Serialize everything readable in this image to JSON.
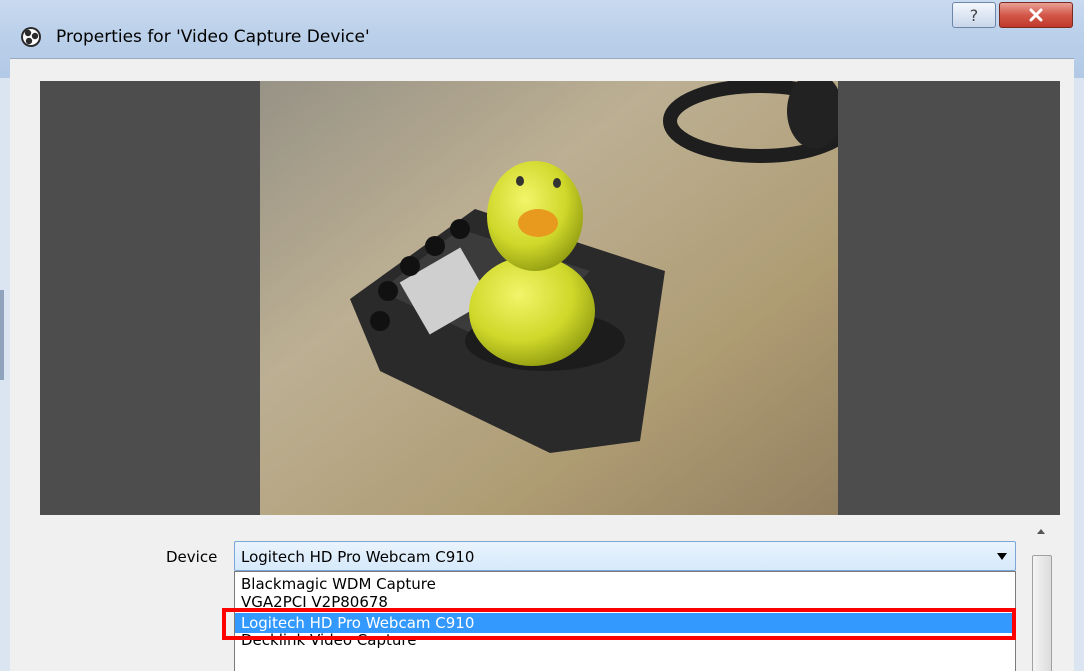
{
  "window": {
    "title": "Properties for 'Video Capture Device'",
    "help_label": "?",
    "icons": {
      "app": "obs-logo-icon",
      "help": "help-icon",
      "close": "close-icon"
    },
    "colors": {
      "close_button": "#c0392b",
      "selection": "#3399ff",
      "highlight_outline": "#ff0000",
      "preview_background": "#4d4d4d"
    }
  },
  "device": {
    "label": "Device",
    "selected": "Logitech HD Pro Webcam C910",
    "options": [
      "Blackmagic WDM Capture",
      "VGA2PCI V2P80678",
      "Logitech HD Pro Webcam C910",
      "Decklink Video Capture"
    ]
  }
}
